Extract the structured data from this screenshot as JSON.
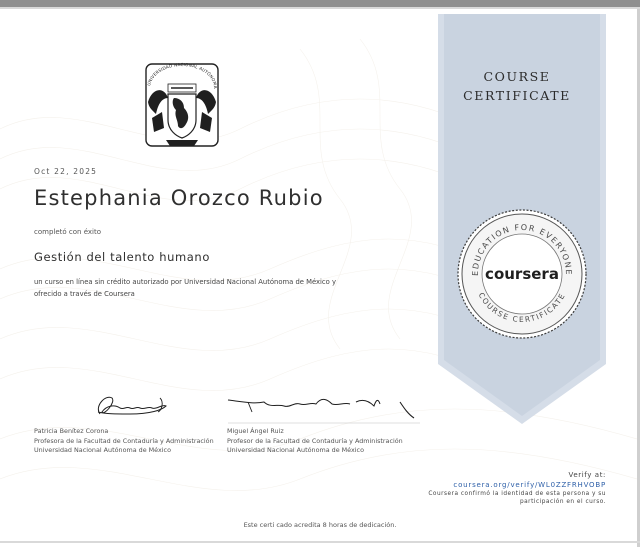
{
  "certificate": {
    "ribbon_title_line1": "COURSE",
    "ribbon_title_line2": "CERTIFICATE",
    "date": "Oct 22, 2025",
    "recipient_name": "Estephania Orozco Rubio",
    "completed_label": "completó con éxito",
    "course_title": "Gestión del talento humano",
    "description_line1": "un curso en línea sin crédito autorizado por Universidad Nacional Autónoma de México y",
    "description_line2": "ofrecido a través de Coursera",
    "hours_note": "Este certi cado acredita 8 horas de dedicación."
  },
  "signers": [
    {
      "name": "Patricia Benítez Corona",
      "title": "Profesora de la Facultad de Contaduría y Administración",
      "institution": "Universidad Nacional Autónoma de México"
    },
    {
      "name": "Miguel Ángel Ruiz",
      "title": "Profesor de la Facultad de Contaduría y Administración",
      "institution": "Universidad Nacional Autónoma de México"
    }
  ],
  "verify": {
    "label": "Verify at:",
    "url": "coursera.org/verify/WL0ZZFRHVOBP",
    "note_line1": "Coursera confirmó la identidad de esta persona y su",
    "note_line2": "participación en el curso."
  },
  "badge": {
    "brand": "coursera",
    "ring_text_top": "EDUCATION FOR EVERYONE",
    "ring_text_bottom": "COURSE CERTIFICATE"
  },
  "seal": {
    "ring_text": "UNIVERSIDAD NACIONAL AUTÓNOMA DE MÉXICO"
  },
  "colors": {
    "ribbon": "#c9d3e0",
    "link": "#2d5fa8",
    "frame": "#8f8f8f"
  }
}
